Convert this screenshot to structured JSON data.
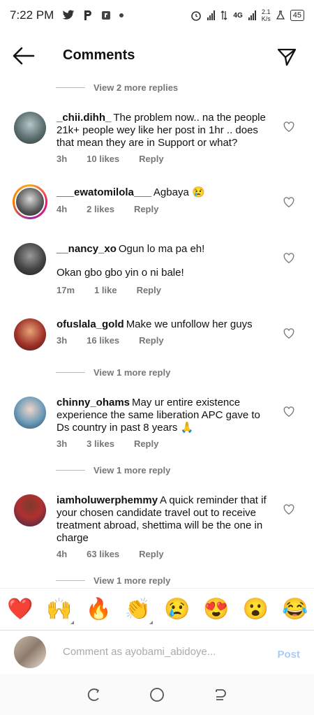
{
  "status": {
    "time": "7:22 PM",
    "net_speed": "2.1",
    "net_unit": "K/s",
    "network": "4G",
    "battery": "45"
  },
  "header": {
    "title": "Comments"
  },
  "view_more": {
    "top": "View 2 more replies",
    "after_ofuslala": "View 1 more reply",
    "after_chinny": "View 1 more reply",
    "bottom": "View 1 more reply"
  },
  "comments": [
    {
      "username": "_chii.dihh_",
      "text": "The problem now.. na the people 21k+ people wey like her post in 1hr .. does that mean they are in Support or what?",
      "time": "3h",
      "likes": "10 likes",
      "reply": "Reply"
    },
    {
      "username": "___ewatomilola___",
      "text": "Agbaya 😢",
      "time": "4h",
      "likes": "2 likes",
      "reply": "Reply"
    },
    {
      "username": "__nancy_xo",
      "text": "Ogun lo ma pa eh!",
      "text2": "Okan gbo gbo yin o ni bale!",
      "time": "17m",
      "likes": "1 like",
      "reply": "Reply"
    },
    {
      "username": "ofuslala_gold",
      "text": "Make we unfollow her guys",
      "time": "3h",
      "likes": "16 likes",
      "reply": "Reply"
    },
    {
      "username": "chinny_ohams",
      "text": "May ur entire existence experience the same liberation APC gave to Ds country in past 8 years 🙏",
      "time": "3h",
      "likes": "3 likes",
      "reply": "Reply"
    },
    {
      "username": "iamholuwerphemmy",
      "text": "A quick reminder that if your chosen candidate travel out to receive treatment abroad, shettima will be the one in charge",
      "time": "4h",
      "likes": "63 likes",
      "reply": "Reply"
    }
  ],
  "emojis": [
    "❤️",
    "🙌",
    "🔥",
    "👏",
    "😢",
    "😍",
    "😮",
    "😂"
  ],
  "input": {
    "placeholder": "Comment as ayobami_abidoye...",
    "post_label": "Post"
  },
  "colors": {
    "post_disabled": "#a7cdf6",
    "muted_text": "#777777"
  }
}
